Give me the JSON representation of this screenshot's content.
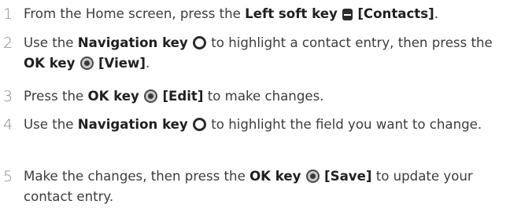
{
  "steps": [
    {
      "number": "1",
      "parts": [
        "From the Home screen, press the ",
        "Left soft key",
        " ",
        "[Contacts]",
        "."
      ]
    },
    {
      "number": "2",
      "parts": [
        "Use the ",
        "Navigation key",
        " to highlight a contact entry, then press the ",
        "OK key",
        " ",
        "[View]",
        "."
      ]
    },
    {
      "number": "3",
      "parts": [
        "Press the ",
        "OK key",
        " ",
        "[Edit]",
        " to make changes."
      ]
    },
    {
      "number": "4",
      "parts": [
        "Use the ",
        "Navigation key",
        " to highlight the field you want to change."
      ]
    },
    {
      "number": "5",
      "parts": [
        "Make the changes, then press the ",
        "OK key",
        " ",
        "[Save]",
        " to update your contact entry."
      ]
    }
  ],
  "icons": {
    "left_soft_key": "left-soft-key-icon",
    "navigation_key": "navigation-key-icon",
    "ok_key": "ok-key-icon"
  }
}
